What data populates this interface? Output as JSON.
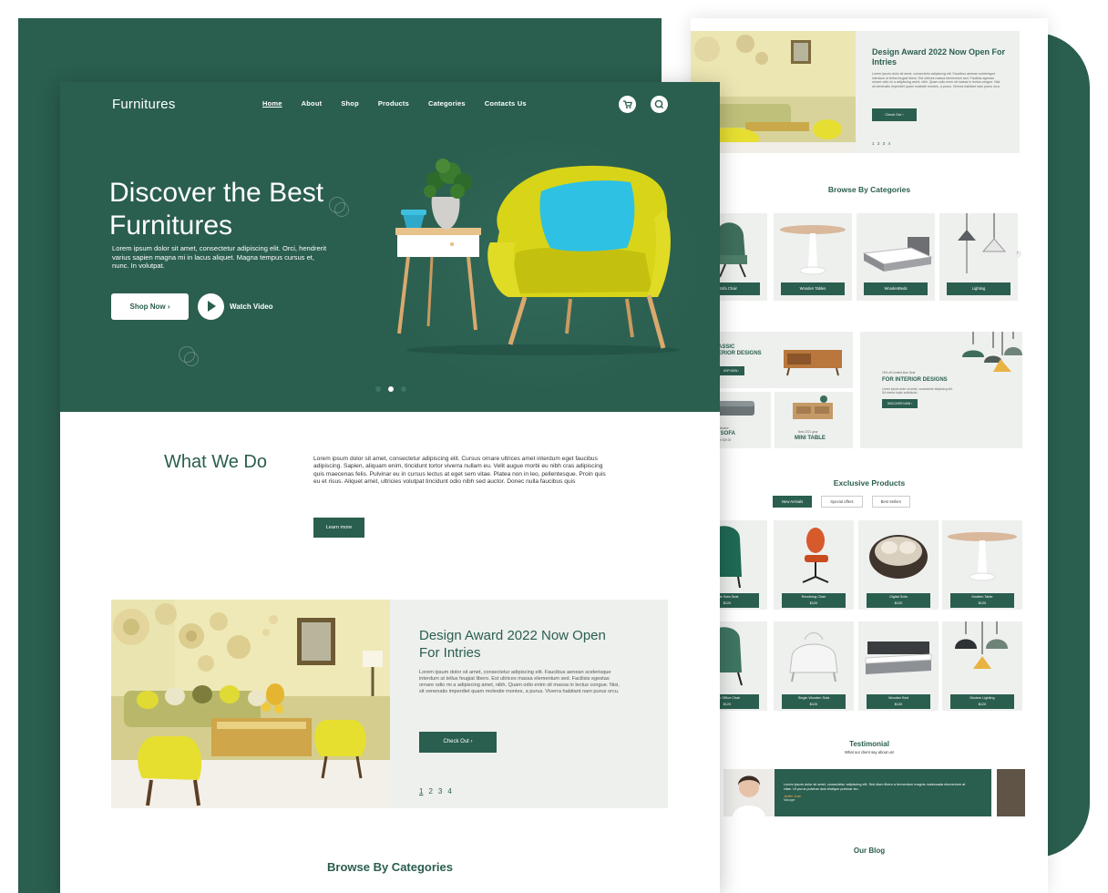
{
  "colors": {
    "brand_green": "#2a5e4f",
    "accent_yellow": "#d9d420",
    "accent_blue": "#2dc0e0",
    "panel_gray": "#eef0ee"
  },
  "site": {
    "logo": "Furnitures",
    "nav": [
      "Home",
      "About",
      "Shop",
      "Products",
      "Categories",
      "Contacts Us"
    ],
    "header_icons": [
      "cart-icon",
      "search-icon"
    ]
  },
  "hero": {
    "title": "Discover the Best Furnitures",
    "description": "Lorem ipsum dolor sit amet, consectetur adipiscing elit. Orci, hendrerit varius sapien magna mi in lacus aliquet. Magna tempus cursus et, nunc. In volutpat.",
    "shop_button": "Shop Now ›",
    "watch_label": "Watch Video",
    "slide_count": 3,
    "active_slide": 2
  },
  "what_we_do": {
    "title": "What We Do",
    "text": "Lorem ipsum dolor sit amet, consectetur adipiscing elit. Cursus ornare ultrices amet interdum eget faucibus adipiscing. Sapien, aliquam enim, tincidunt tortor viverra nullam eu. Velit augue morbi eu nibh cras adipiscing quis maecenas felis. Pulvinar eu in cursus lectus at eget sem vitae. Platea non in leo, pellentesque. Proin quis eu et risus. Aliquet amet, ultricies volutpat tincidunt odio nibh sed auctor. Donec nulla faucibus quis",
    "button": "Learn more"
  },
  "award": {
    "title": "Design Award 2022 Now Open For Intries",
    "text": "Lorem ipsum dolor sit amet, consectetur adipiscing elit. Faucibus aenean scelerisque interdum ut tellus feugiat libero. Est ultrices massa elementum sed. Facilisis egestas ornare odio mi a adipiscing amet, nibh. Quam odio enim sit massa in lectus congue. Nisi, sit venenatis imperdiet quam molestie montes, a purus. Viverra habitant nam purus orcu.",
    "button": "Check Out ›",
    "pages": [
      "1",
      "2",
      "3",
      "4"
    ],
    "active_page": "1"
  },
  "browse_title": "Browse By Categories",
  "right_page": {
    "award": {
      "title": "Design Award 2022 Now Open For Intries",
      "text": "Lorem ipsum dolor sit amet, consectetur adipiscing elit. Faucibus aenean scelerisque interdum ut tellus feugiat libero. Est ultrices massa elementum sed. Facilisis egestas ornare odio mi a adipiscing amet, nibh. Quam odio enim sit massa in lectus congue. Nisi, sit venenatis imperdiet quam molestie montes, a purus. Viverra habitant nam purus orcu.",
      "button": "Check Out ›",
      "pages": "1 2 3 4"
    },
    "browse_title": "Browse By Categories",
    "categories": [
      "Sofa Chair",
      "Wooden Tables",
      "WoodenBeds",
      "Lighting"
    ],
    "banners": {
      "classic_title_1": "ASSIC",
      "classic_title_2": "ERIOR DESIGNS",
      "classic_button": "HOP NOW ›",
      "offer_text": "15% off Limited time Deal",
      "offer_title": "FOR INTERIOR DESIGNS",
      "offer_desc": "Lorem ipsum dolor sit amet, consectetur adipiscing elit. Sit viverra turpis sollicitudin.",
      "offer_button": "DISCOVER NOW ›",
      "sofa_small": "Initiative",
      "sofa_title": "NG SOFA",
      "sofa_sub": "ery Sale $49.00",
      "table_small": "Best 2021 gear",
      "table_title": "MINI TABLE"
    },
    "exclusive_title": "Exclusive Products",
    "tabs": [
      "New Arrivals",
      "Special offers",
      "Best Sellers"
    ],
    "active_tab": "New Arrivals",
    "products_row1": [
      {
        "name": "ngle Sofa Seat",
        "price": "$120"
      },
      {
        "name": "Revolving Chair",
        "price": "$120"
      },
      {
        "name": "Digital Sofa",
        "price": "$120"
      },
      {
        "name": "Modern Table",
        "price": "$120"
      }
    ],
    "products_row2": [
      {
        "name": "dern Office Chair",
        "price": "$120"
      },
      {
        "name": "Single Wooden Sofa",
        "price": "$120"
      },
      {
        "name": "Wooden Bed",
        "price": "$120"
      },
      {
        "name": "Modern Lighting",
        "price": "$120"
      }
    ],
    "testimonial": {
      "title": "Testimonial",
      "subtitle": "What our client say about us!",
      "quote": "Lorem ipsum dolor sit amet, consectetur adipiscing elit. Sed diam libero a fermentum magnis malesuada elementum at vitae. Ut purus pulvinar duis tristique pulvinar leo.",
      "name": "Jenifer Jenin",
      "role": "Manager"
    },
    "blog_title": "Our Blog"
  }
}
